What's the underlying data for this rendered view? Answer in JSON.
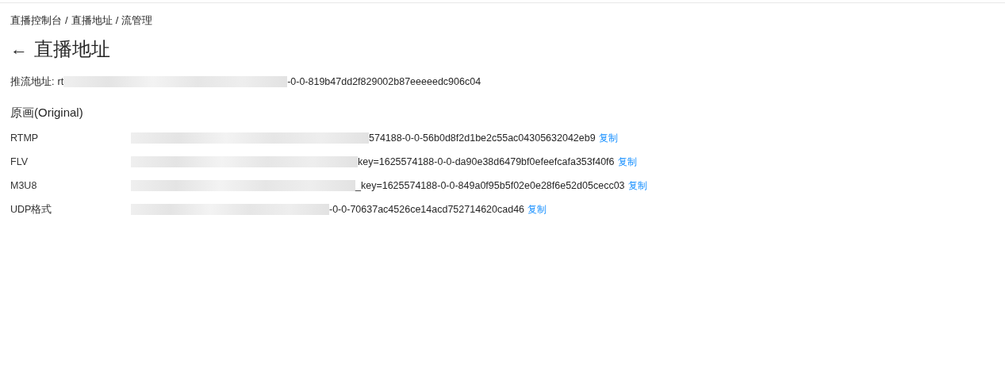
{
  "breadcrumb": [
    "直播控制台",
    "直播地址",
    "流管理"
  ],
  "breadcrumb_separator": "/",
  "title": {
    "back_icon": "←",
    "text": "直播地址"
  },
  "push_url": {
    "label": "推流地址:",
    "visible_start": "rt",
    "visible_end": "-0-0-819b47dd2f829002b87eeeeedc906c04"
  },
  "section_title": "原画(Original)",
  "rows": [
    {
      "label": "RTMP",
      "visible_end": "574188-0-0-56b0d8f2d1be2c55ac04305632042eb9",
      "copy": "复制"
    },
    {
      "label": "FLV",
      "visible_end": "key=1625574188-0-0-da90e38d6479bf0efeefcafa353f40f6",
      "copy": "复制"
    },
    {
      "label": "M3U8",
      "visible_end": "_key=1625574188-0-0-849a0f95b5f02e0e28f6e52d05cecc03",
      "copy": "复制"
    },
    {
      "label": "UDP格式",
      "visible_end": "-0-0-70637ac4526ce14acd752714620cad46",
      "copy": "复制"
    }
  ]
}
